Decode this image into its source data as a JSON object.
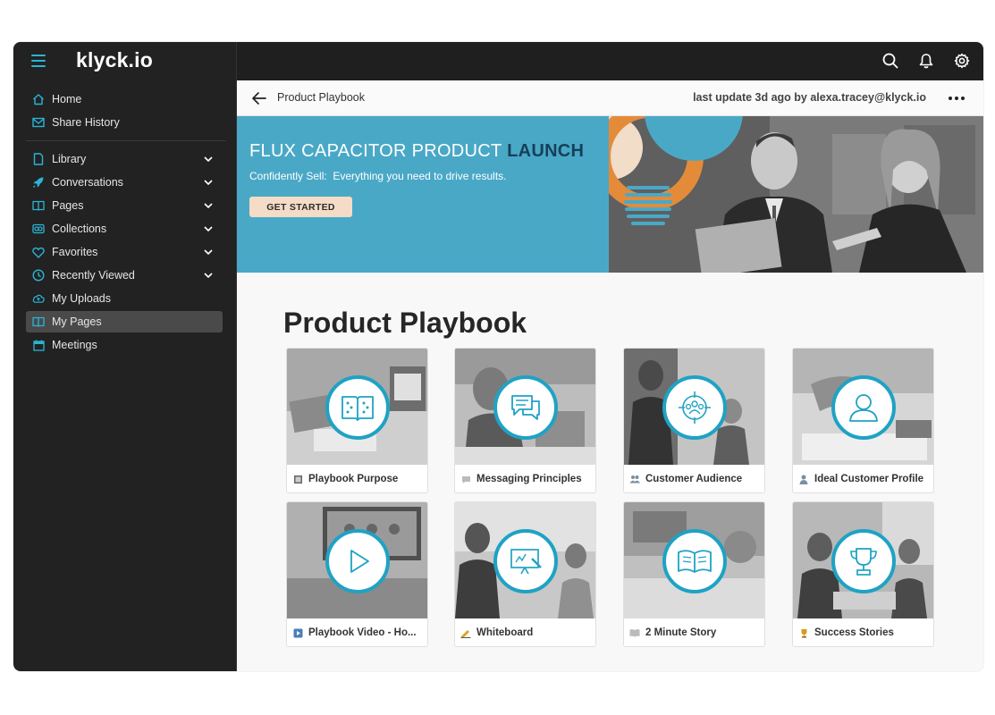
{
  "app": {
    "logo": "klyck.io"
  },
  "topbar": {
    "icons": [
      "search-icon",
      "bell-icon",
      "gear-icon"
    ]
  },
  "sidebar": {
    "items": [
      {
        "label": "Home",
        "icon": "home-icon",
        "chevron": false
      },
      {
        "label": "Share History",
        "icon": "mail-icon",
        "chevron": false
      },
      {
        "label": "Library",
        "icon": "document-icon",
        "chevron": true
      },
      {
        "label": "Conversations",
        "icon": "rocket-icon",
        "chevron": true
      },
      {
        "label": "Pages",
        "icon": "book-icon",
        "chevron": true
      },
      {
        "label": "Collections",
        "icon": "collections-icon",
        "chevron": true
      },
      {
        "label": "Favorites",
        "icon": "heart-icon",
        "chevron": true
      },
      {
        "label": "Recently Viewed",
        "icon": "clock-icon",
        "chevron": true
      },
      {
        "label": "My Uploads",
        "icon": "cloud-upload-icon",
        "chevron": false
      },
      {
        "label": "My Pages",
        "icon": "book-icon",
        "chevron": false,
        "active": true
      },
      {
        "label": "Meetings",
        "icon": "calendar-icon",
        "chevron": false
      }
    ]
  },
  "header": {
    "title": "Product Playbook",
    "last_update": "last update 3d ago by alexa.tracey@klyck.io"
  },
  "banner": {
    "title_plain": "FLUX CAPACITOR PRODUCT ",
    "title_bold": "LAUNCH",
    "subtitle": "Confidently Sell:  Everything you need to drive results.",
    "button": "GET STARTED"
  },
  "content": {
    "title": "Product Playbook",
    "cards": [
      {
        "label": "Playbook Purpose",
        "icon": "book-icon"
      },
      {
        "label": "Messaging Principles",
        "icon": "chat-icon"
      },
      {
        "label": "Customer Audience",
        "icon": "audience-icon"
      },
      {
        "label": "Ideal Customer Profile",
        "icon": "user-icon"
      },
      {
        "label": "Playbook Video - Ho...",
        "icon": "play-icon"
      },
      {
        "label": "Whiteboard",
        "icon": "whiteboard-icon"
      },
      {
        "label": "2 Minute Story",
        "icon": "open-book-icon"
      },
      {
        "label": "Success Stories",
        "icon": "trophy-icon"
      }
    ]
  },
  "colors": {
    "accent": "#1fa2c4",
    "banner_blue": "#4aa8c7",
    "banner_dark_text": "#16405a",
    "button_peach": "#f4dcc6",
    "sidebar_bg": "#222222",
    "active_item": "#4a4a4a"
  }
}
